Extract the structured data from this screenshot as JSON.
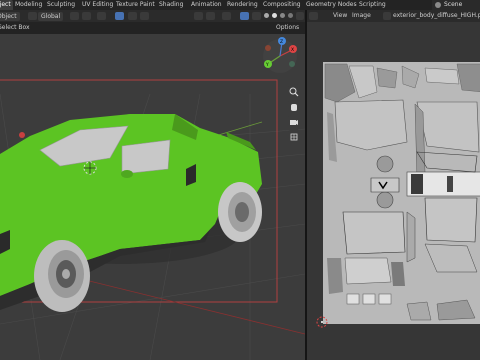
{
  "topbar": {
    "tabs": [
      "oject",
      "Modeling",
      "Sculpting",
      "UV Editing",
      "Texture Paint",
      "Shading",
      "Animation",
      "Rendering",
      "Compositing",
      "Geometry Nodes",
      "Scripting"
    ],
    "active_tab": "oject",
    "scene_label": "Scene"
  },
  "viewport_header": {
    "mode": "Object",
    "transform": "Global",
    "select_box": "Select Box",
    "options": "Options"
  },
  "uv_header": {
    "view": "View",
    "image": "Image",
    "image_name": "exterior_body_diffuse_HIGH.png"
  },
  "gizmo": {
    "x": "X",
    "y": "Y",
    "z": "Z"
  },
  "colors": {
    "car_body": "#5cc423",
    "tire": "#c7c7c7",
    "ui_bg": "#2b2b2b",
    "accent_blue": "#4772b3",
    "camera_frame": "#b04040"
  },
  "icons": [
    "select-box-icon",
    "global-transform-icon",
    "snap-icon",
    "proportional-edit-icon",
    "visibility-icon",
    "shading-icon",
    "zoom-icon",
    "hand-pan-icon",
    "camera-icon",
    "grid-icon",
    "cursor-icon"
  ]
}
